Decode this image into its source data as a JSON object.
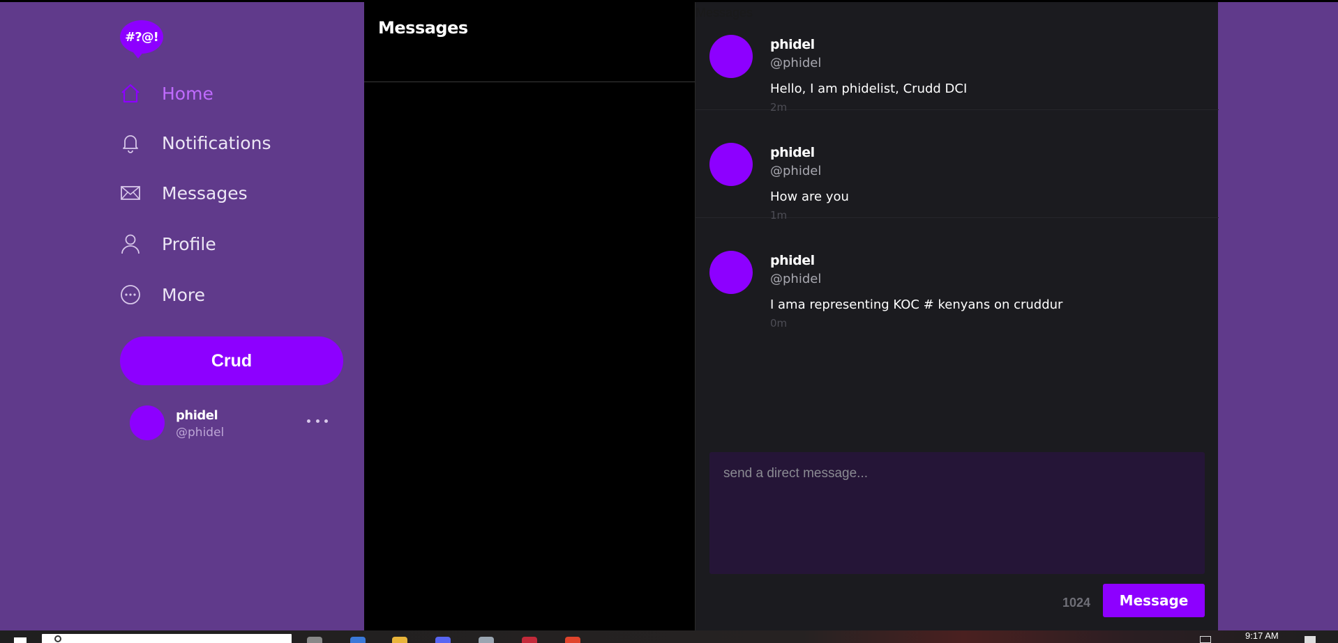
{
  "app": {
    "logo_text": "#?@!"
  },
  "sidebar": {
    "items": [
      {
        "label": "Home",
        "icon": "home-icon",
        "active": true
      },
      {
        "label": "Notifications",
        "icon": "bell-icon",
        "active": false
      },
      {
        "label": "Messages",
        "icon": "envelope-icon",
        "active": false
      },
      {
        "label": "Profile",
        "icon": "user-icon",
        "active": false
      },
      {
        "label": "More",
        "icon": "more-circle-icon",
        "active": false
      }
    ],
    "crud_button_label": "Crud",
    "account": {
      "name": "phidel",
      "handle": "@phidel"
    }
  },
  "inbox": {
    "title": "Messages"
  },
  "conversation": {
    "label": "Messages",
    "messages": [
      {
        "name": "phidel",
        "handle": "@phidel",
        "text": "Hello, I am phidelist, Crudd DCI",
        "time": "2m"
      },
      {
        "name": "phidel",
        "handle": "@phidel",
        "text": "How are you",
        "time": "1m"
      },
      {
        "name": "phidel",
        "handle": "@phidel",
        "text": "I ama representing KOC # kenyans on cruddur",
        "time": "0m"
      }
    ],
    "composer": {
      "placeholder": "send a direct message...",
      "value": "",
      "char_count": "1024",
      "send_label": "Message"
    }
  },
  "taskbar": {
    "clock": "9:17 AM"
  },
  "colors": {
    "background": "#603a8b",
    "accent": "#8d00ff",
    "active_nav": "#c06bff",
    "panel": "#1b1b1f",
    "composer_bg": "#251537"
  }
}
